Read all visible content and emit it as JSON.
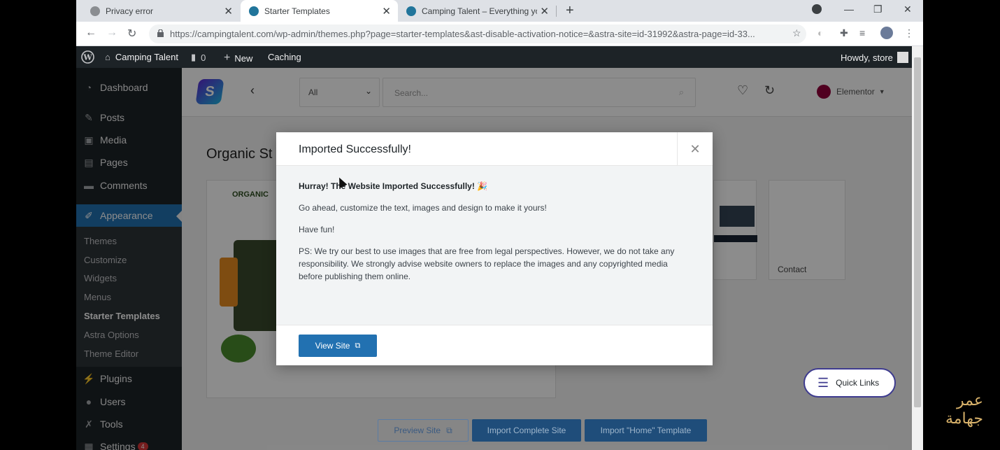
{
  "browser": {
    "tabs": [
      {
        "title": "Privacy error",
        "active": false
      },
      {
        "title": "Starter Templates",
        "active": true
      },
      {
        "title": "Camping Talent – Everything you",
        "active": false
      }
    ],
    "url": "https://campingtalent.com/wp-admin/themes.php?page=starter-templates&ast-disable-activation-notice=&astra-site=id-31992&astra-page=id-33..."
  },
  "adminbar": {
    "site_name": "Camping Talent",
    "comments_count": "0",
    "new_label": "New",
    "caching_label": "Caching",
    "howdy": "Howdy, store"
  },
  "sidebar": {
    "items": [
      {
        "label": "Dashboard",
        "icon": "dashboard-icon"
      },
      {
        "label": "Posts",
        "icon": "pin-icon"
      },
      {
        "label": "Media",
        "icon": "media-icon"
      },
      {
        "label": "Pages",
        "icon": "pages-icon"
      },
      {
        "label": "Comments",
        "icon": "comment-icon"
      },
      {
        "label": "Appearance",
        "icon": "brush-icon"
      },
      {
        "label": "Plugins",
        "icon": "plugin-icon"
      },
      {
        "label": "Users",
        "icon": "user-icon"
      },
      {
        "label": "Tools",
        "icon": "wrench-icon"
      },
      {
        "label": "Settings",
        "icon": "settings-icon",
        "badge": "4"
      }
    ],
    "submenu": [
      "Themes",
      "Customize",
      "Widgets",
      "Menus",
      "Starter Templates",
      "Astra Options",
      "Theme Editor"
    ]
  },
  "starter": {
    "filter_select": "All",
    "search_placeholder": "Search...",
    "builder": "Elementor",
    "site_title": "Organic St",
    "page_label": "Contact",
    "logo_text": "ORGANIC"
  },
  "modal": {
    "title": "Imported Successfully!",
    "line1": "Hurray! The Website Imported Successfully! 🎉",
    "line2": "Go ahead, customize the text, images and design to make it yours!",
    "line3": "Have fun!",
    "line4": "PS: We try our best to use images that are free from legal perspectives. However, we do not take any responsibility. We strongly advise website owners to replace the images and any copyrighted media before publishing them online.",
    "button": "View Site"
  },
  "bottom": {
    "preview": "Preview Site",
    "import_complete": "Import Complete Site",
    "import_home": "Import \"Home\" Template"
  },
  "quick_links": "Quick Links",
  "watermark": [
    "عمر",
    "جهامة"
  ]
}
